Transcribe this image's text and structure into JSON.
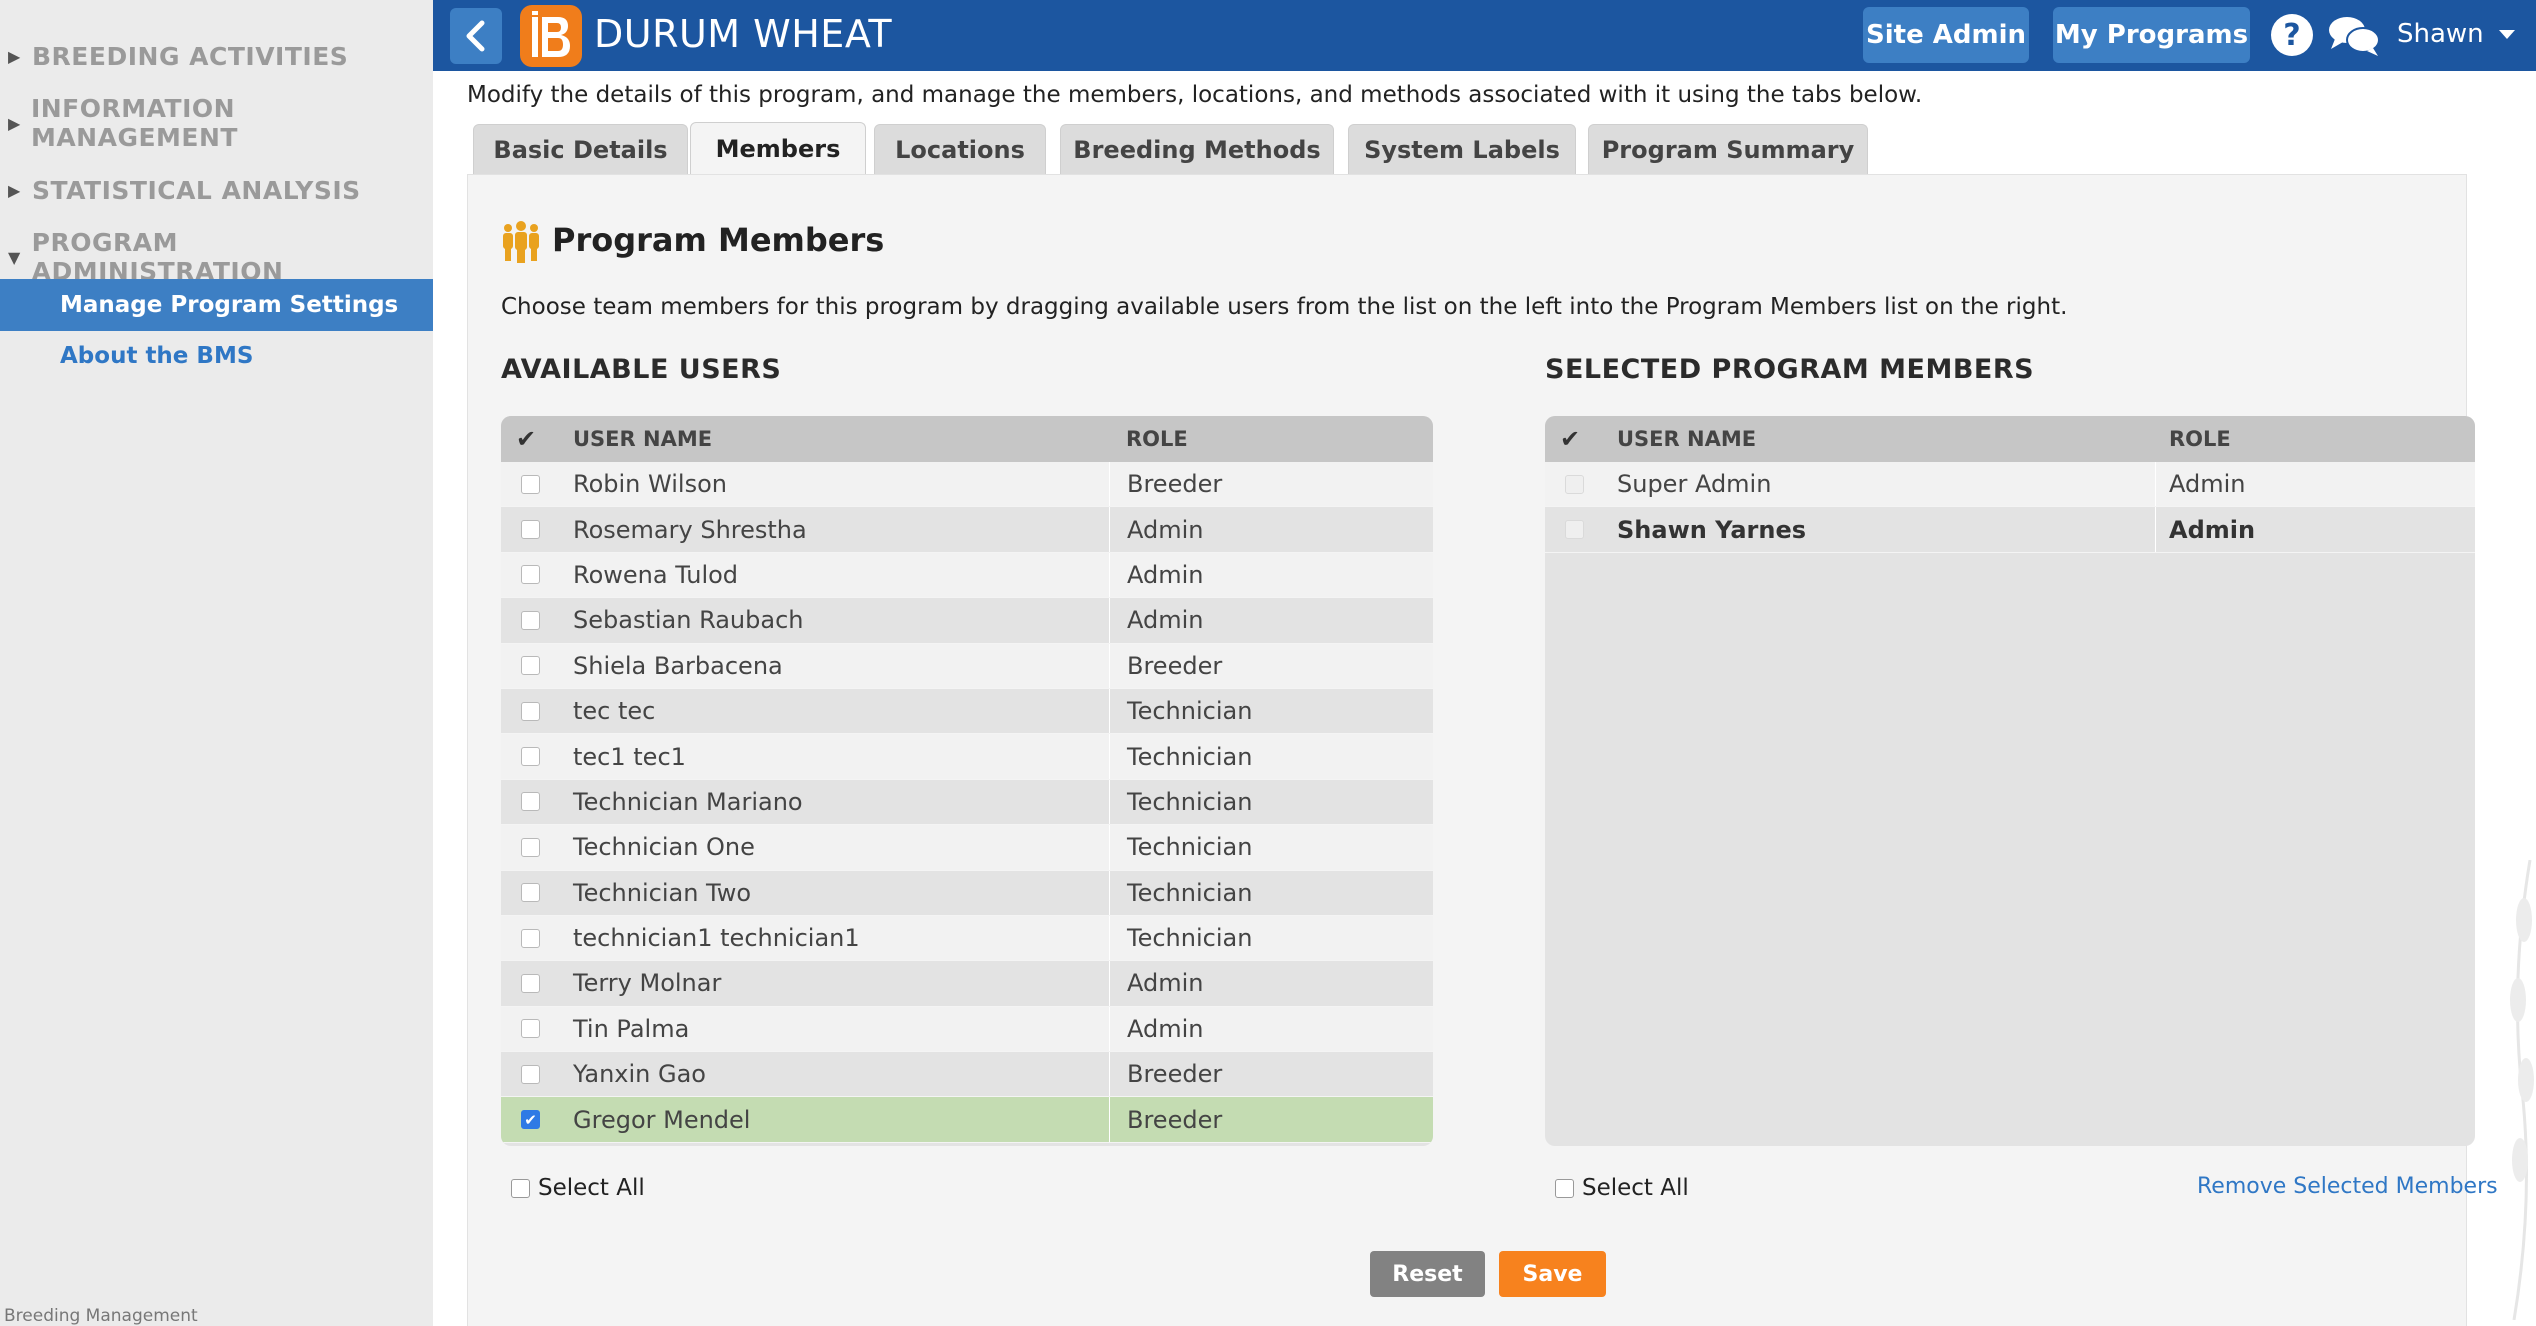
{
  "sidebar": {
    "sections": [
      {
        "label": "BREEDING ACTIVITIES",
        "expanded": false
      },
      {
        "label": "INFORMATION MANAGEMENT",
        "expanded": false
      },
      {
        "label": "STATISTICAL ANALYSIS",
        "expanded": false
      },
      {
        "label": "PROGRAM ADMINISTRATION",
        "expanded": true
      }
    ],
    "active_item": "Manage Program Settings",
    "other_item": "About the BMS",
    "footer": "Breeding Management"
  },
  "header": {
    "title": "DURUM WHEAT",
    "site_admin": "Site Admin",
    "my_programs": "My Programs",
    "help_icon": "?",
    "user": "Shawn"
  },
  "intro": "Modify the details of this program, and manage the members, locations, and methods associated with it using the tabs below.",
  "tabs": [
    {
      "label": "Basic Details"
    },
    {
      "label": "Members"
    },
    {
      "label": "Locations"
    },
    {
      "label": "Breeding Methods"
    },
    {
      "label": "System Labels"
    },
    {
      "label": "Program Summary"
    }
  ],
  "active_tab": "Members",
  "members": {
    "title": "Program Members",
    "description": "Choose team members for this program by dragging available users from the list on the left into the Program Members list on the right.",
    "available": {
      "heading": "AVAILABLE USERS",
      "col_user": "USER NAME",
      "col_role": "ROLE",
      "rows": [
        {
          "name": "Robin Wilson",
          "role": "Breeder"
        },
        {
          "name": "Rosemary Shrestha",
          "role": "Admin"
        },
        {
          "name": "Rowena Tulod",
          "role": "Admin"
        },
        {
          "name": "Sebastian Raubach",
          "role": "Admin"
        },
        {
          "name": "Shiela Barbacena",
          "role": "Breeder"
        },
        {
          "name": "tec tec",
          "role": "Technician"
        },
        {
          "name": "tec1 tec1",
          "role": "Technician"
        },
        {
          "name": "Technician Mariano",
          "role": "Technician"
        },
        {
          "name": "Technician One",
          "role": "Technician"
        },
        {
          "name": "Technician Two",
          "role": "Technician"
        },
        {
          "name": "technician1 technician1",
          "role": "Technician"
        },
        {
          "name": "Terry Molnar",
          "role": "Admin"
        },
        {
          "name": "Tin Palma",
          "role": "Admin"
        },
        {
          "name": "Yanxin Gao",
          "role": "Breeder"
        },
        {
          "name": "Gregor Mendel",
          "role": "Breeder"
        }
      ],
      "checked_row": "Gregor Mendel",
      "select_all": "Select All"
    },
    "selected": {
      "heading": "SELECTED PROGRAM MEMBERS",
      "col_user": "USER NAME",
      "col_role": "ROLE",
      "rows": [
        {
          "name": "Super Admin",
          "role": "Admin"
        },
        {
          "name": "Shawn Yarnes",
          "role": "Admin"
        }
      ],
      "select_all": "Select All",
      "remove_label": "Remove Selected Members"
    }
  },
  "buttons": {
    "reset": "Reset",
    "save": "Save"
  },
  "colors": {
    "header_bg": "#1c56a0",
    "accent_blue": "#3d7fc4",
    "save_orange": "#f7821e",
    "selected_row": "#c4dcb2"
  }
}
